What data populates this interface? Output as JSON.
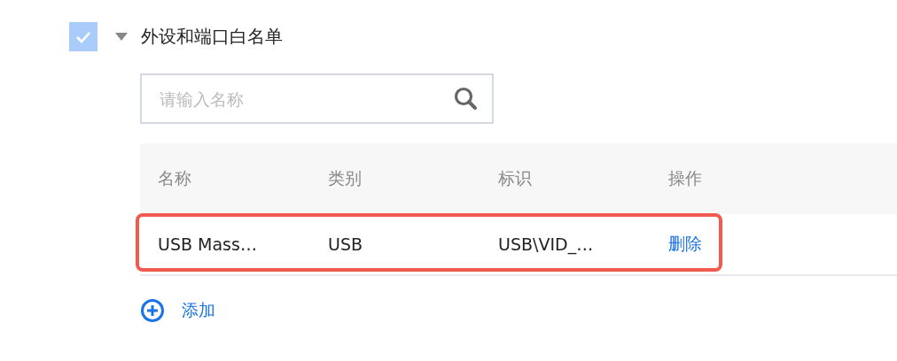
{
  "section": {
    "checked": true,
    "expanded": true,
    "title": "外设和端口白名单"
  },
  "search": {
    "placeholder": "请输入名称"
  },
  "table": {
    "columns": [
      "名称",
      "类别",
      "标识",
      "操作"
    ],
    "rows": [
      {
        "highlighted": true,
        "cells": [
          "USB Mass…",
          "USB",
          "USB\\VID_…"
        ],
        "action": "删除"
      }
    ]
  },
  "add_button": {
    "label": "添加"
  }
}
